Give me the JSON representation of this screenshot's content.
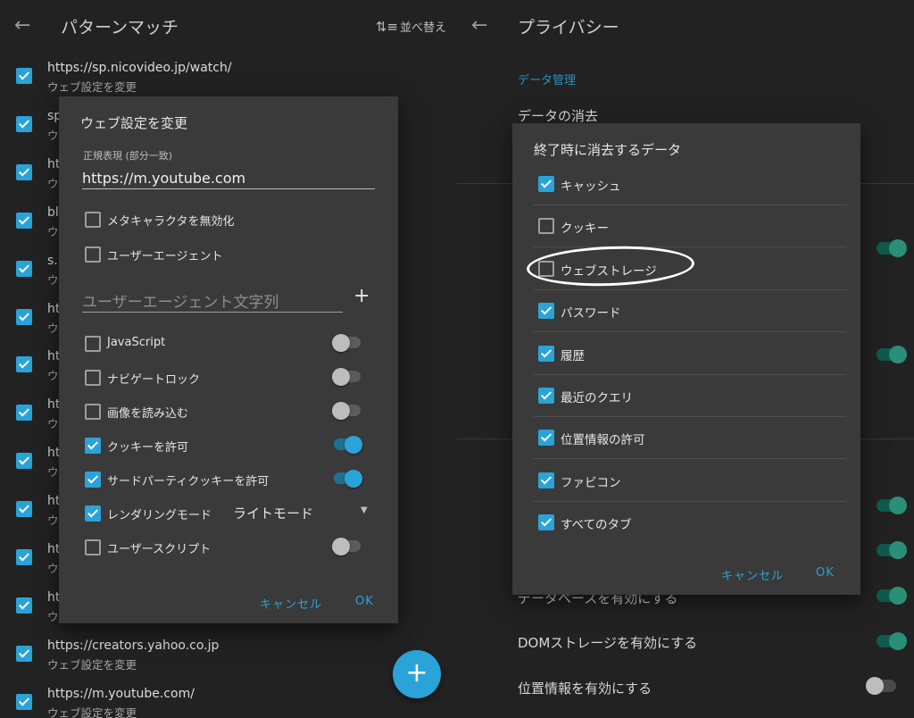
{
  "left": {
    "title": "パターンマッチ",
    "sort_label": "並べ替え",
    "sort_icon": "sort-icon",
    "back_icon": "arrow-left-icon",
    "list": [
      {
        "url": "https://sp.nicovideo.jp/watch/",
        "sub": "ウェブ設定を変更",
        "checked": true
      },
      {
        "url": "sp",
        "sub": "ウ",
        "checked": true
      },
      {
        "url": "ht",
        "sub": "ウ",
        "checked": true
      },
      {
        "url": "bl",
        "sub": "ウ",
        "checked": true
      },
      {
        "url": "s.l",
        "sub": "ウ",
        "checked": true
      },
      {
        "url": "ht",
        "sub": "ウ",
        "checked": true
      },
      {
        "url": "ht",
        "sub": "ウ",
        "checked": true
      },
      {
        "url": "ht",
        "sub": "ウ",
        "checked": true
      },
      {
        "url": "ht",
        "sub": "ウ",
        "checked": true
      },
      {
        "url": "ht",
        "sub": "ウ",
        "checked": true
      },
      {
        "url": "ht",
        "sub": "ウ",
        "checked": true
      },
      {
        "url": "ht",
        "sub": "ウ",
        "checked": true
      },
      {
        "url": "https://creators.yahoo.co.jp",
        "sub": "ウェブ設定を変更",
        "checked": true
      },
      {
        "url": "https://m.youtube.com/",
        "sub": "ウェブ設定を変更",
        "checked": true
      }
    ],
    "fab_label": "+",
    "dialog": {
      "title": "ウェブ設定を変更",
      "field_label": "正規表現 (部分一致)",
      "field_value": "https://m.youtube.com",
      "opt_meta": "メタキャラクタを無効化",
      "opt_ua": "ユーザーエージェント",
      "ua_placeholder": "ユーザーエージェント文字列",
      "add_icon": "+",
      "options": [
        {
          "label": "JavaScript",
          "checked": false,
          "toggle": false
        },
        {
          "label": "ナビゲートロック",
          "checked": false,
          "toggle": false
        },
        {
          "label": "画像を読み込む",
          "checked": false,
          "toggle": false
        },
        {
          "label": "クッキーを許可",
          "checked": true,
          "toggle": true
        },
        {
          "label": "サードパーティクッキーを許可",
          "checked": true,
          "toggle": true
        }
      ],
      "render_mode_label": "レンダリングモード",
      "render_mode_value": "ライトモード",
      "user_script": "ユーザースクリプト",
      "cancel": "キャンセル",
      "ok": "OK"
    }
  },
  "right": {
    "title": "プライバシー",
    "back_icon": "arrow-left-icon",
    "section": "データ管理",
    "clear_data": "データの消去",
    "database_label": "データベースを有効にする",
    "dom_storage_label": "DOMストレージを有効にする",
    "location_label": "位置情報を有効にする",
    "dialog": {
      "title": "終了時に消去するデータ",
      "items": [
        {
          "label": "キャッシュ",
          "checked": true
        },
        {
          "label": "クッキー",
          "checked": false
        },
        {
          "label": "ウェブストレージ",
          "checked": false
        },
        {
          "label": "パスワード",
          "checked": true
        },
        {
          "label": "履歴",
          "checked": true
        },
        {
          "label": "最近のクエリ",
          "checked": true
        },
        {
          "label": "位置情報の許可",
          "checked": true
        },
        {
          "label": "ファビコン",
          "checked": true
        },
        {
          "label": "すべてのタブ",
          "checked": true
        }
      ],
      "cancel": "キャンセル",
      "ok": "OK"
    }
  },
  "colors": {
    "accent": "#2aa3d8",
    "switch_on": "#2b8f78",
    "background": "#222222",
    "dialog": "#3a3a3a"
  }
}
